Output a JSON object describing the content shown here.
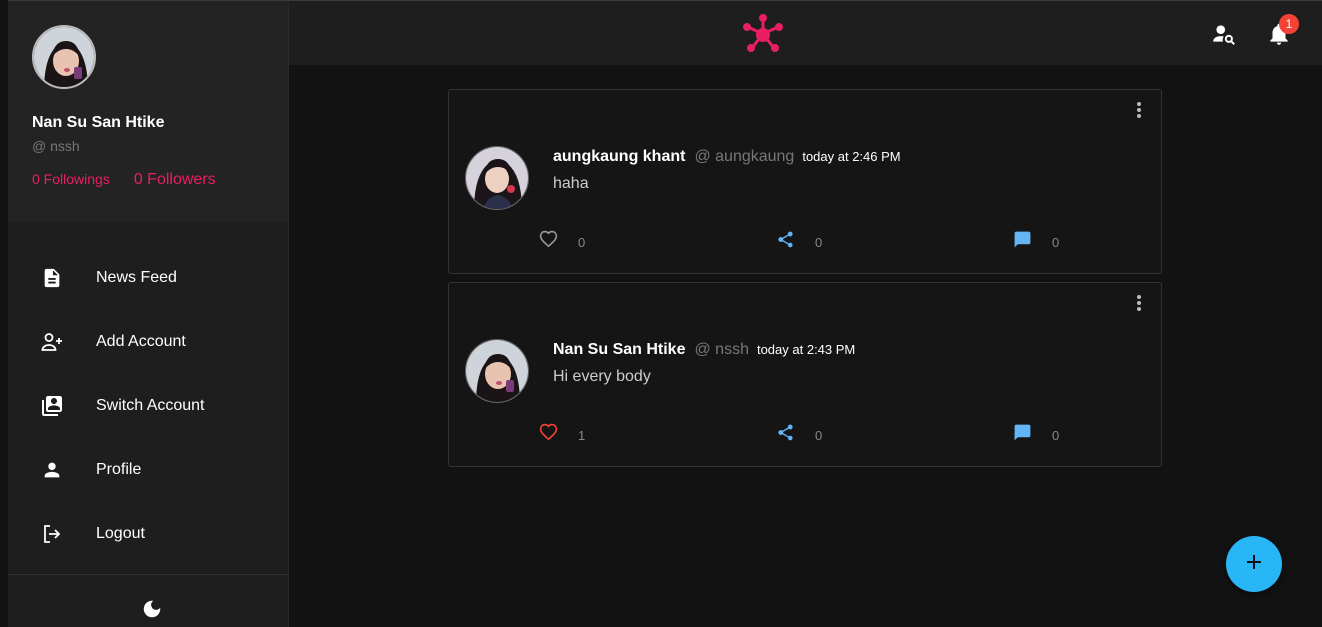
{
  "colors": {
    "accent": "#e91e63",
    "fab": "#29b6f6",
    "badge": "#f44336",
    "share": "#64b5f6",
    "liked": "#f44336"
  },
  "profile": {
    "name": "Nan Su San Htike",
    "handle": "@ nssh",
    "followings": "0 Followings",
    "followers": "0 Followers"
  },
  "nav": {
    "items": [
      {
        "label": "News Feed",
        "icon": "article-icon"
      },
      {
        "label": "Add Account",
        "icon": "person-add-icon"
      },
      {
        "label": "Switch Account",
        "icon": "switch-account-icon"
      },
      {
        "label": "Profile",
        "icon": "person-icon"
      },
      {
        "label": "Logout",
        "icon": "logout-icon"
      }
    ]
  },
  "topbar": {
    "logo_icon": "hub-logo-icon",
    "notification_count": "1"
  },
  "posts": [
    {
      "name": "aungkaung khant",
      "handle": "@ aungkaung",
      "time": "today at 2:46 PM",
      "text": "haha",
      "likes": "0",
      "shares": "0",
      "comments": "0",
      "liked": false
    },
    {
      "name": "Nan Su San Htike",
      "handle": "@ nssh",
      "time": "today at 2:43 PM",
      "text": "Hi every body",
      "likes": "1",
      "shares": "0",
      "comments": "0",
      "liked": true
    }
  ]
}
